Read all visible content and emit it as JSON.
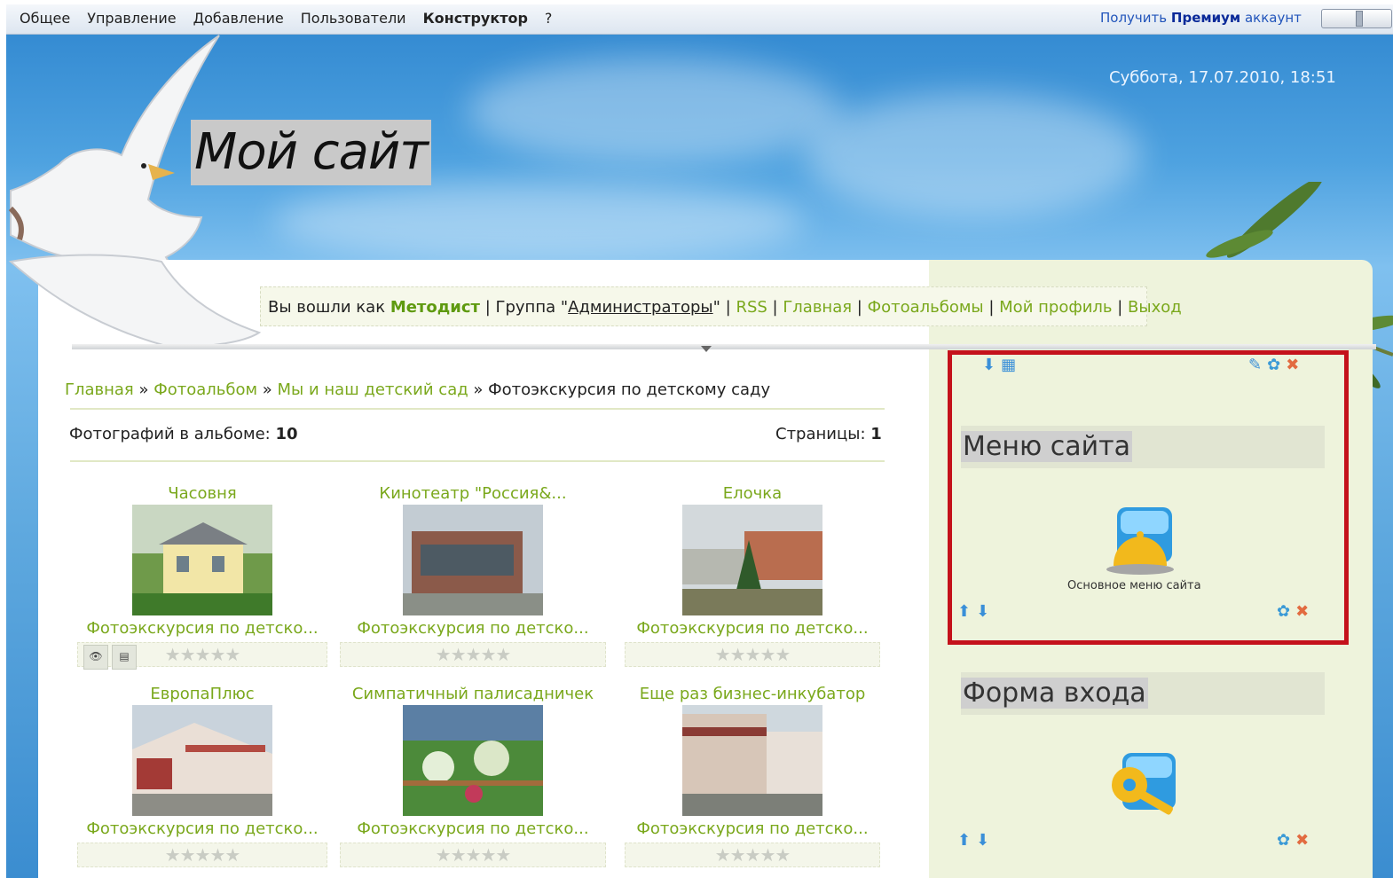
{
  "topbar": {
    "menu": [
      "Общее",
      "Управление",
      "Добавление",
      "Пользователи",
      "Конструктор",
      "?"
    ],
    "premium_pre": "Получить",
    "premium_bold": "Премиум",
    "premium_post": "аккаунт"
  },
  "header": {
    "date": "Суббота, 17.07.2010, 18:51",
    "site_title": "Мой сайт"
  },
  "userbar": {
    "logged_in": "Вы вошли как",
    "username": "Методист",
    "group_pre": "| Группа \"",
    "group_name": "Администраторы",
    "group_post": "\" |",
    "links": [
      "RSS",
      "Главная",
      "Фотоальбомы",
      "Мой профиль",
      "Выход"
    ]
  },
  "breadcrumb": {
    "items": [
      "Главная",
      "Фотоальбом",
      "Мы и наш детский сад"
    ],
    "current": "Фотоэкскурсия по детскому саду",
    "sep": " » "
  },
  "album": {
    "count_label": "Фотографий в альбоме:",
    "count": "10",
    "pages_label": "Страницы:",
    "pages": "1",
    "photos": [
      {
        "title": "Часовня",
        "desc": "Фотоэкскурсия по детско..."
      },
      {
        "title": "Кинотеатр \"Россия&...",
        "desc": "Фотоэкскурсия по детско..."
      },
      {
        "title": "Елочка",
        "desc": "Фотоэкскурсия по детско..."
      },
      {
        "title": "ЕвропаПлюс",
        "desc": "Фотоэкскурсия по детско..."
      },
      {
        "title": "Симпатичный палисадничек",
        "desc": "Фотоэкскурсия по детско..."
      },
      {
        "title": "Еще раз бизнес-инкубатор",
        "desc": "Фотоэкскурсия по детско..."
      }
    ],
    "stars": "★★★★★"
  },
  "sidebar": {
    "menu_block_title": "Меню сайта",
    "menu_block_caption": "Основное меню сайта",
    "login_block_title": "Форма входа"
  },
  "colors": {
    "link_green": "#7aa81c",
    "highlight_red": "#c4111b",
    "sidebar_bg": "#eef3dc"
  }
}
